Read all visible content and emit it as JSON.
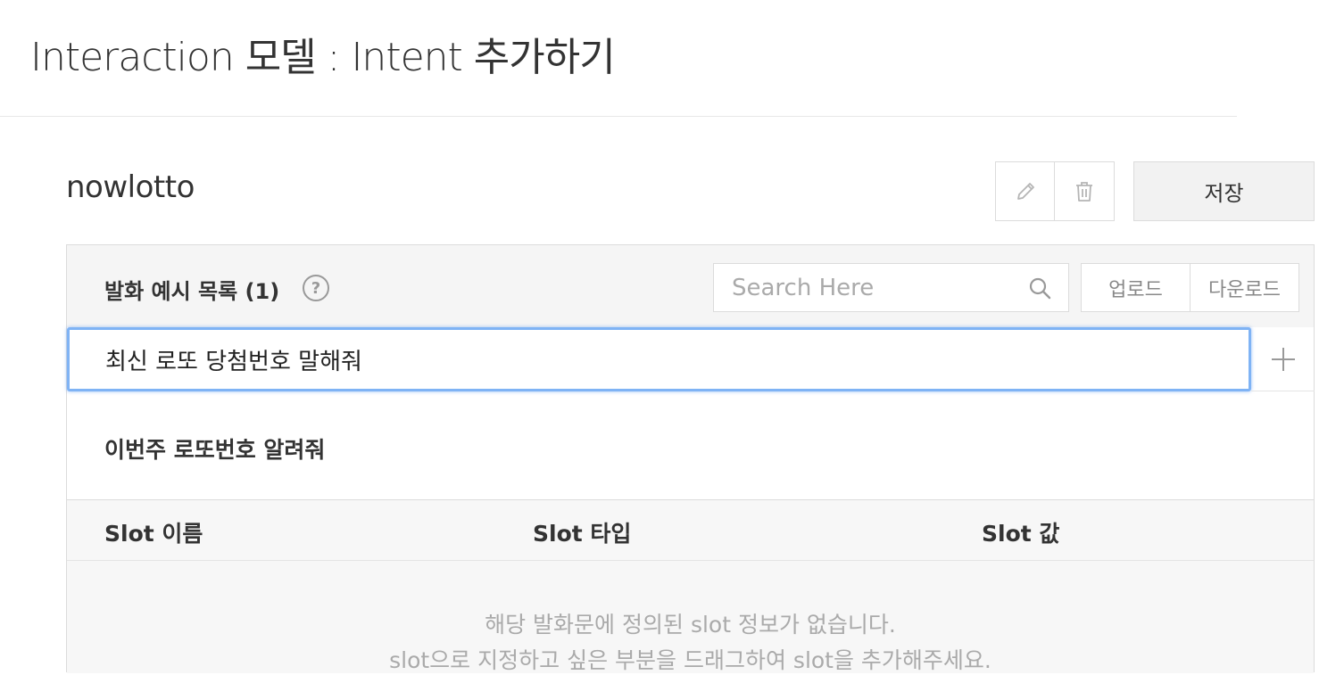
{
  "page": {
    "title": "Interaction 모델 : Intent 추가하기"
  },
  "intent": {
    "name": "nowlotto",
    "save_label": "저장",
    "edit_icon": "pencil-icon",
    "delete_icon": "trash-icon"
  },
  "utterances": {
    "section_label": "발화 예시 목록 (1)",
    "help_icon_glyph": "?",
    "search_placeholder": "Search Here",
    "upload_label": "업로드",
    "download_label": "다운로드",
    "input_value": "최신 로또 당첨번호 말해줘",
    "items": [
      {
        "text": "이번주 로또번호 알려줘"
      }
    ]
  },
  "slots": {
    "columns": [
      "Slot 이름",
      "Slot 타입",
      "Slot 값"
    ],
    "empty_message_line1": "해당 발화문에 정의된 slot 정보가 없습니다.",
    "empty_message_line2": "slot으로 지정하고 싶은 부분을 드래그하여 slot을 추가해주세요."
  },
  "colors": {
    "focus_border": "#7fb3f5",
    "header_bg": "#f5f5f5",
    "border": "#dcdcdc",
    "muted_text": "#aaaaaa"
  }
}
